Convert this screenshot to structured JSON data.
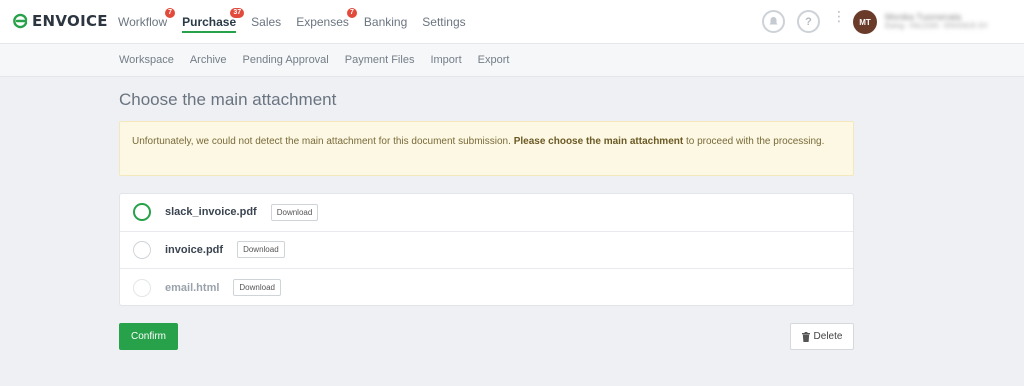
{
  "app": {
    "brand": "ENVOICE"
  },
  "nav": {
    "items": [
      {
        "label": "Workflow",
        "badge": "7"
      },
      {
        "label": "Purchase",
        "badge": "37",
        "active": true
      },
      {
        "label": "Sales",
        "badge": ""
      },
      {
        "label": "Expenses",
        "badge": "7"
      },
      {
        "label": "Banking",
        "badge": ""
      },
      {
        "label": "Settings",
        "badge": ""
      }
    ]
  },
  "user": {
    "initials": "MT",
    "name": "Monika Tuomenala",
    "subtitle": "Ewing - FALCON - ENVOICE OY"
  },
  "top_icons": {
    "help": "?"
  },
  "subnav": {
    "items": [
      "Workspace",
      "Archive",
      "Pending Approval",
      "Payment Files",
      "Import",
      "Export"
    ]
  },
  "page": {
    "title": "Choose the main attachment",
    "alert_text": "Unfortunately, we could not detect the main attachment for this document submission. ",
    "alert_bold": "Please choose the main attachment",
    "alert_tail": " to proceed with the processing."
  },
  "attachments": [
    {
      "name": "slack_invoice.pdf",
      "download": "Download",
      "selected": true
    },
    {
      "name": "invoice.pdf",
      "download": "Download",
      "selected": false
    },
    {
      "name": "email.html",
      "download": "Download",
      "selected": false,
      "dim": true
    }
  ],
  "actions": {
    "confirm": "Confirm",
    "delete": "Delete"
  },
  "colors": {
    "brand": "#27a14a",
    "badge": "#e24a3b",
    "alert_bg": "#fcf8e3"
  }
}
